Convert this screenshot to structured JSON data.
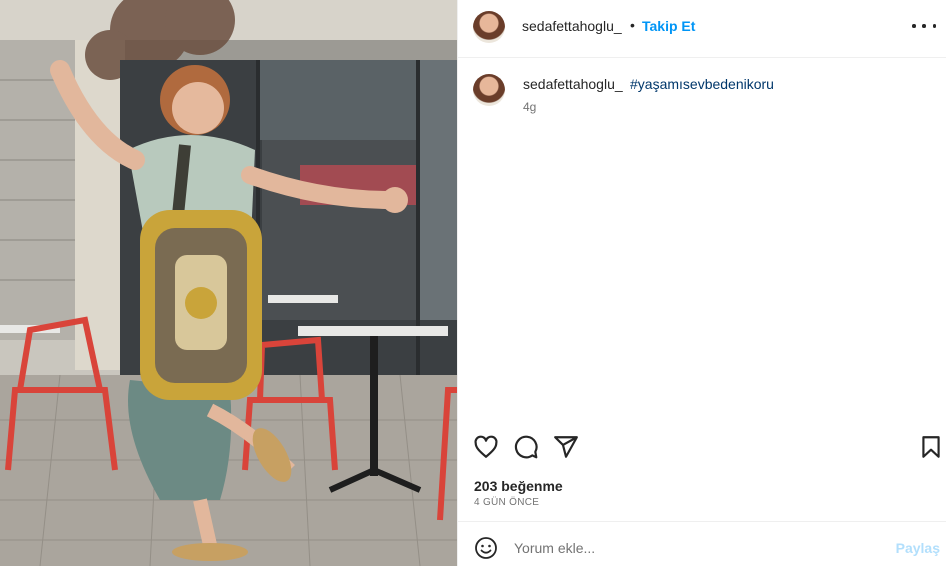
{
  "post": {
    "username": "sedafettahoglu_",
    "separator": "•",
    "follow_label": "Takip Et",
    "caption_user": "sedafettahoglu_",
    "hashtag": "#yaşamısevbedenikoru",
    "caption_age": "4g",
    "likes": "203 beğenme",
    "posted_when": "4 GÜN ÖNCE"
  },
  "comment": {
    "placeholder": "Yorum ekle...",
    "post_label": "Paylaş"
  },
  "icons": {
    "more": "more-options-icon",
    "like": "heart-icon",
    "comment": "comment-icon",
    "share": "send-icon",
    "save": "bookmark-icon",
    "emoji": "emoji-icon"
  },
  "colors": {
    "link_blue": "#0095f6",
    "hashtag_blue": "#00376b",
    "post_disabled": "#b2dffc"
  }
}
